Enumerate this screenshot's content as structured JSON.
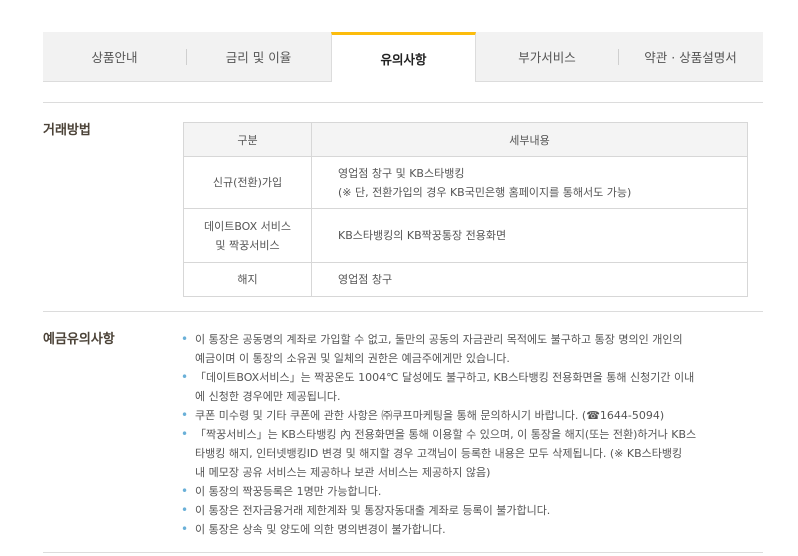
{
  "tabs": [
    {
      "label": "상품안내",
      "active": false
    },
    {
      "label": "금리 및 이율",
      "active": false
    },
    {
      "label": "유의사항",
      "active": true
    },
    {
      "label": "부가서비스",
      "active": false
    },
    {
      "label": "약관 · 상품설명서",
      "active": false
    }
  ],
  "colors": {
    "accent": "#fcbc0c",
    "title": "#4b4237",
    "bullet": "#6ab0d8"
  },
  "transaction": {
    "title": "거래방법",
    "headers": [
      "구분",
      "세부내용"
    ],
    "rows": [
      {
        "type_lines": [
          "신규(전환)가입"
        ],
        "detail_lines": [
          "영업점 창구 및 KB스타뱅킹",
          "(※ 단, 전환가입의 경우 KB국민은행 홈페이지를 통해서도 가능)"
        ]
      },
      {
        "type_lines": [
          "데이트BOX 서비스",
          "및 짝꿍서비스"
        ],
        "detail_lines": [
          "KB스타뱅킹의 KB짝꿍통장 전용화면"
        ]
      },
      {
        "type_lines": [
          "해지"
        ],
        "detail_lines": [
          "영업점 창구"
        ]
      }
    ]
  },
  "notice": {
    "title": "예금유의사항",
    "items": [
      [
        "이 통장은 공동명의 계좌로 가입할 수 없고, 둘만의 공동의 자금관리 목적에도 불구하고 통장 명의인 개인의",
        "예금이며 이 통장의 소유권 및 일체의 권한은 예금주에게만 있습니다."
      ],
      [
        "「데이트BOX서비스」는 짝꿍온도 1004℃ 달성에도 불구하고, KB스타뱅킹 전용화면을 통해 신청기간 이내",
        "에 신청한 경우에만 제공됩니다."
      ],
      [
        "쿠폰 미수령 및 기타 쿠폰에 관한 사항은 ㈜쿠프마케팅을 통해 문의하시기 바랍니다. (☎1644-5094)"
      ],
      [
        "「짝꿍서비스」는 KB스타뱅킹 內 전용화면을 통해 이용할 수 있으며, 이 통장을 해지(또는 전환)하거나 KB스",
        "타뱅킹 해지, 인터넷뱅킹ID 변경 및 해지할 경우 고객님이 등록한 내용은 모두 삭제됩니다. (※ KB스타뱅킹",
        "내 메모장 공유 서비스는 제공하나 보관 서비스는 제공하지 않음)"
      ],
      [
        "이 통장의 짝꿍등록은 1명만 가능합니다."
      ],
      [
        "이 통장은 전자금융거래 제한계좌 및 통장자동대출 계좌로 등록이 불가합니다."
      ],
      [
        "이 통장은 상속 및 양도에 의한 명의변경이 불가합니다."
      ]
    ]
  }
}
